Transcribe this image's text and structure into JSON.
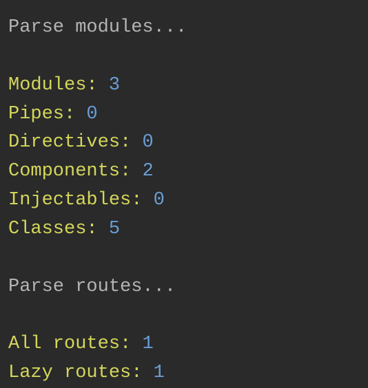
{
  "sections": {
    "parse_modules": {
      "header": "Parse modules...",
      "items": [
        {
          "label": "Modules:",
          "value": "3"
        },
        {
          "label": "Pipes:",
          "value": "0"
        },
        {
          "label": "Directives:",
          "value": "0"
        },
        {
          "label": "Components:",
          "value": "2"
        },
        {
          "label": "Injectables:",
          "value": "0"
        },
        {
          "label": "Classes:",
          "value": "5"
        }
      ]
    },
    "parse_routes": {
      "header": "Parse routes...",
      "items": [
        {
          "label": "All routes:",
          "value": "1"
        },
        {
          "label": "Lazy routes:",
          "value": "1"
        }
      ]
    }
  }
}
